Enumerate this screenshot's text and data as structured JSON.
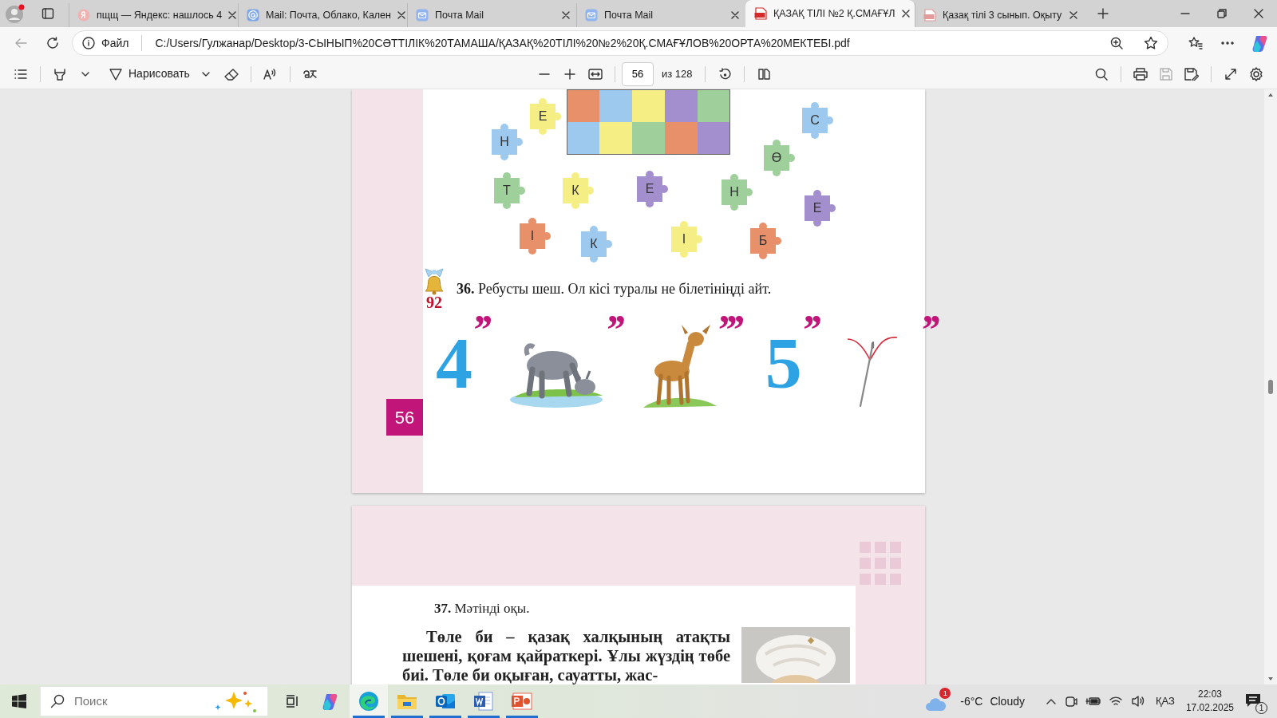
{
  "browser": {
    "tabs": [
      {
        "title": "пщщ — Яндекс: нашлось 4",
        "kind": "yandex",
        "selected": false
      },
      {
        "title": "Mail: Почта, Облако, Кален",
        "kind": "at",
        "selected": false
      },
      {
        "title": "Почта Mail",
        "kind": "mail",
        "selected": false
      },
      {
        "title": "Почта Mail",
        "kind": "mail",
        "selected": false
      },
      {
        "title": "ҚАЗАҚ ТІЛІ №2 Қ.СМАҒҰЛ",
        "kind": "pdf",
        "selected": true
      },
      {
        "title": "Қазақ тілі 3 сынып. Оқыту",
        "kind": "pdf-faded",
        "selected": false
      }
    ],
    "address_bar": {
      "scheme_label": "Файл",
      "url": "C:/Users/Гулжанар/Desktop/3-СЫНЫП%20СӘТТІЛІК%20ТАМАША/ҚАЗАҚ%20ТІЛІ%20№2%20Қ.СМАҒҰЛОВ%20ОРТА%20МЕКТЕБІ.pdf"
    }
  },
  "pdf_toolbar": {
    "draw_label": "Нарисовать",
    "page": "56",
    "page_count": "из 128",
    "save_disabled": true
  },
  "document": {
    "puzzle_pieces": [
      {
        "letter": "Е",
        "color": "#f4ee84"
      },
      {
        "letter": "Н",
        "color": "#9dc9ef"
      },
      {
        "letter": "С",
        "color": "#9dc9ef"
      },
      {
        "letter": "Ө",
        "color": "#9fd09c"
      },
      {
        "letter": "Т",
        "color": "#9fd09c"
      },
      {
        "letter": "К",
        "color": "#f4ee84"
      },
      {
        "letter": "Е",
        "color": "#a48fce"
      },
      {
        "letter": "Н",
        "color": "#9fd09c"
      },
      {
        "letter": "Е",
        "color": "#a48fce"
      },
      {
        "letter": "І",
        "color": "#e8906a"
      },
      {
        "letter": "К",
        "color": "#9dc9ef"
      },
      {
        "letter": "І",
        "color": "#f4ee84"
      },
      {
        "letter": "Б",
        "color": "#e8906a"
      }
    ],
    "exercise": {
      "number": "36.",
      "text": "Ребусты шеш. Ол кісі туралы не білетініңді айт.",
      "bell_badge": "92"
    },
    "rebus": [
      {
        "kind": "digit",
        "text": "4",
        "mark": "’’"
      },
      {
        "kind": "goat",
        "mark": "’’"
      },
      {
        "kind": "deer",
        "mark": "’’’"
      },
      {
        "kind": "digit",
        "text": "5",
        "mark": "’’"
      },
      {
        "kind": "needle",
        "mark": "’’"
      }
    ],
    "page_number": "56",
    "next_page": {
      "exercise_number": "37.",
      "exercise_text": "Мәтінді оқы.",
      "paragraph": "Төле би – қазақ халқының атақты шешені, қоғам қайраткері. Ұлы жүздің төбе биі. Төле би оқыған, сауатты, жас-"
    }
  },
  "taskbar": {
    "search_placeholder": "Поиск",
    "apps": [
      {
        "kind": "edge",
        "running": true,
        "selected": true
      },
      {
        "kind": "explorer",
        "running": true,
        "selected": false
      },
      {
        "kind": "outlook",
        "running": true,
        "selected": false
      },
      {
        "kind": "word",
        "running": true,
        "selected": false
      },
      {
        "kind": "powerpoint",
        "running": true,
        "selected": false
      }
    ],
    "weather": {
      "badge": "1",
      "temperature": "-6°C",
      "condition": "Cloudy"
    },
    "language": "ҚАЗ",
    "time": "22:03",
    "date": "17.02.2025",
    "notifications": "1"
  }
}
